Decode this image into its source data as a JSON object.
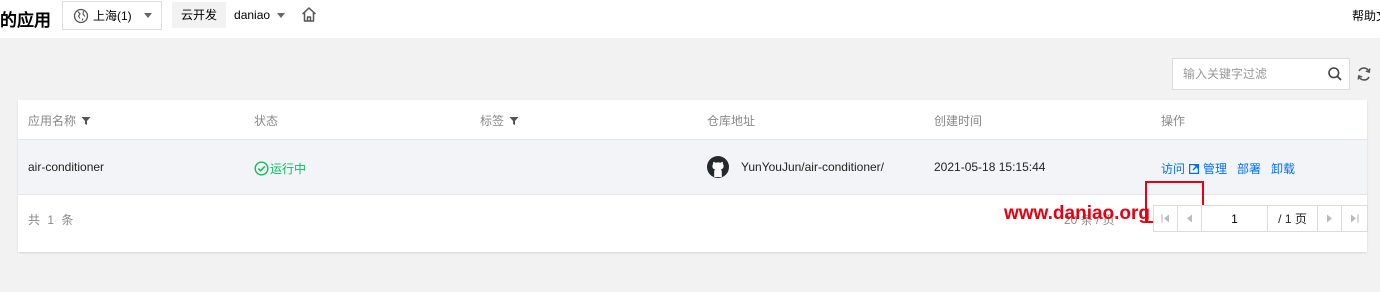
{
  "header": {
    "page_title": "的应用",
    "region": "上海(1)",
    "env_label": "云开发",
    "env_name": "daniao",
    "help": "帮助文"
  },
  "search": {
    "placeholder": "输入关键字过滤"
  },
  "table": {
    "columns": [
      "应用名称",
      "状态",
      "标签",
      "仓库地址",
      "创建时间",
      "操作"
    ],
    "rows": [
      {
        "name": "air-conditioner",
        "status": "运行中",
        "repo": "YunYouJun/air-conditioner/",
        "created": "2021-05-18 15:15:44",
        "actions": [
          "访问",
          "管理",
          "部署",
          "卸载"
        ]
      }
    ]
  },
  "footer": {
    "total": "共 1 条",
    "page_size": "20 条 / 页",
    "current_page": "1",
    "total_pages": "/ 1 页"
  },
  "watermark": "www.daniao.org",
  "colors": {
    "accent": "#006eff",
    "success": "#0abf5b",
    "highlight": "#e60012"
  }
}
